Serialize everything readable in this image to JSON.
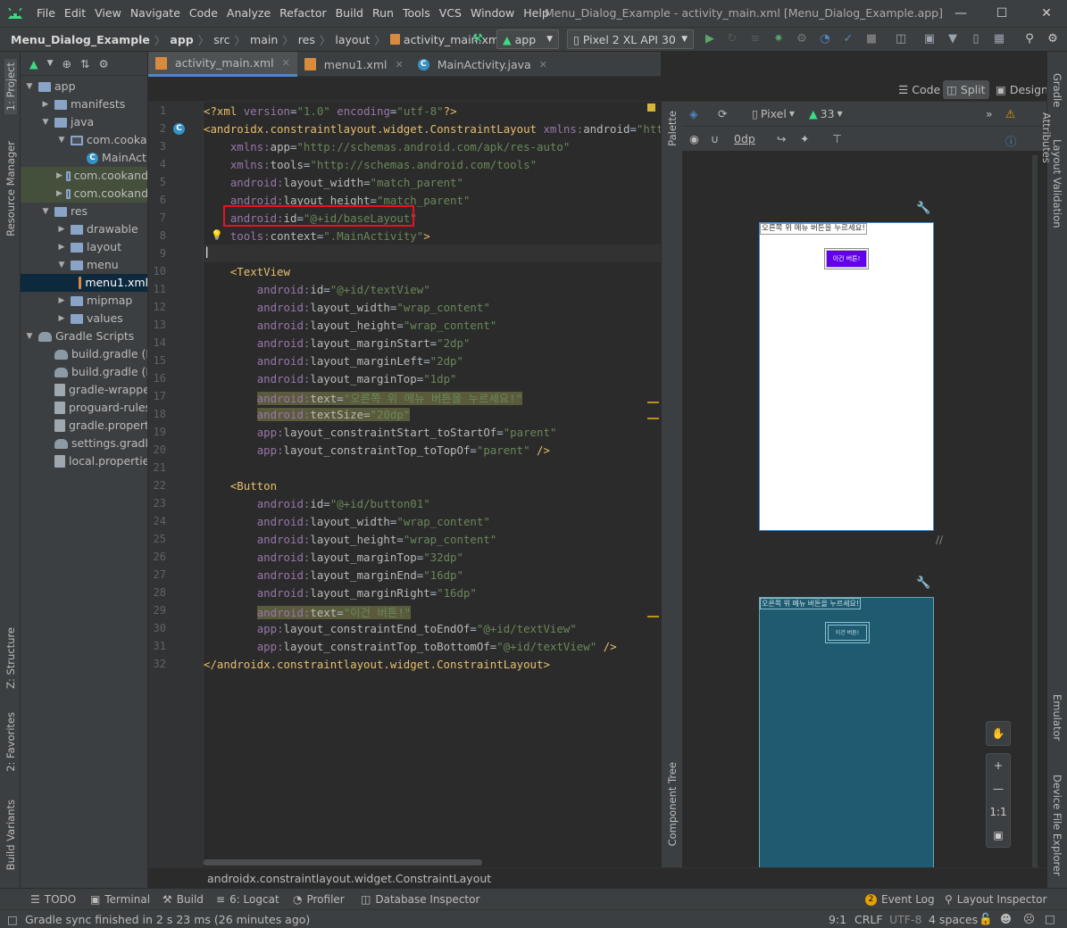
{
  "window": {
    "title": "Menu_Dialog_Example - activity_main.xml [Menu_Dialog_Example.app]",
    "menu": [
      "File",
      "Edit",
      "View",
      "Navigate",
      "Code",
      "Analyze",
      "Refactor",
      "Build",
      "Run",
      "Tools",
      "VCS",
      "Window",
      "Help"
    ]
  },
  "nav": {
    "crumbs": [
      "Menu_Dialog_Example",
      "app",
      "src",
      "main",
      "res",
      "layout",
      "activity_main.xml"
    ],
    "config": "app",
    "device": "Pixel 2 XL API 30"
  },
  "project": {
    "tree": [
      {
        "label": "app",
        "indent": 0,
        "arrow": "▼",
        "icon": "folder"
      },
      {
        "label": "manifests",
        "indent": 1,
        "arrow": "▶",
        "icon": "folder"
      },
      {
        "label": "java",
        "indent": 1,
        "arrow": "▼",
        "icon": "folder"
      },
      {
        "label": "com.cookand",
        "indent": 2,
        "arrow": "▼",
        "icon": "pkg"
      },
      {
        "label": "MainActivi",
        "indent": 3,
        "arrow": "",
        "icon": "class"
      },
      {
        "label": "com.cookand",
        "indent": 2,
        "arrow": "▶",
        "icon": "pkg"
      },
      {
        "label": "com.cookand",
        "indent": 2,
        "arrow": "▶",
        "icon": "pkg"
      },
      {
        "label": "res",
        "indent": 1,
        "arrow": "▼",
        "icon": "folder"
      },
      {
        "label": "drawable",
        "indent": 2,
        "arrow": "▶",
        "icon": "folder"
      },
      {
        "label": "layout",
        "indent": 2,
        "arrow": "▶",
        "icon": "folder"
      },
      {
        "label": "menu",
        "indent": 2,
        "arrow": "▼",
        "icon": "folder"
      },
      {
        "label": "menu1.xml",
        "indent": 3,
        "arrow": "",
        "icon": "xml"
      },
      {
        "label": "mipmap",
        "indent": 2,
        "arrow": "▶",
        "icon": "folder"
      },
      {
        "label": "values",
        "indent": 2,
        "arrow": "▶",
        "icon": "folder"
      },
      {
        "label": "Gradle Scripts",
        "indent": 0,
        "arrow": "▼",
        "icon": "gradle"
      },
      {
        "label": "build.gradle (Pro",
        "indent": 1,
        "arrow": "",
        "icon": "gradle"
      },
      {
        "label": "build.gradle (Mo",
        "indent": 1,
        "arrow": "",
        "icon": "gradle"
      },
      {
        "label": "gradle-wrapper.p",
        "indent": 1,
        "arrow": "",
        "icon": "file"
      },
      {
        "label": "proguard-rules.p",
        "indent": 1,
        "arrow": "",
        "icon": "file"
      },
      {
        "label": "gradle.propertie",
        "indent": 1,
        "arrow": "",
        "icon": "file"
      },
      {
        "label": "settings.gradle (",
        "indent": 1,
        "arrow": "",
        "icon": "gradle"
      },
      {
        "label": "local.properties",
        "indent": 1,
        "arrow": "",
        "icon": "file"
      }
    ]
  },
  "left_tabs": [
    "1: Project",
    "Resource Manager",
    "Z: Structure",
    "2: Favorites",
    "Build Variants"
  ],
  "right_tabs": [
    "Gradle",
    "Layout Validation",
    "Attributes",
    "Emulator",
    "Device File Explorer"
  ],
  "editor_tabs": [
    {
      "label": "activity_main.xml",
      "active": true
    },
    {
      "label": "menu1.xml",
      "active": false
    },
    {
      "label": "MainActivity.java",
      "active": false
    }
  ],
  "view_modes": [
    "Code",
    "Split",
    "Design"
  ],
  "palette_labels": {
    "palette": "Palette",
    "tree": "Component Tree"
  },
  "code_lines": [
    "1",
    "2",
    "3",
    "4",
    "5",
    "6",
    "7",
    "8",
    "9",
    "10",
    "11",
    "12",
    "13",
    "14",
    "15",
    "16",
    "17",
    "18",
    "19",
    "20",
    "21",
    "22",
    "23",
    "24",
    "25",
    "26",
    "27",
    "28",
    "29",
    "30",
    "31",
    "32"
  ],
  "design_toolbar": {
    "device": "Pixel",
    "api": "33",
    "margin": "0dp"
  },
  "preview": {
    "textview_text": "오른쪽 위 메뉴 버튼을 누르세요!",
    "button_text": "이건 버튼!"
  },
  "zoom": {
    "one_to_one": "1:1"
  },
  "editor_breadcrumb": "androidx.constraintlayout.widget.ConstraintLayout",
  "bottom_tools": [
    "TODO",
    "Terminal",
    "Build",
    "6: Logcat",
    "Profiler",
    "Database Inspector",
    "Event Log",
    "Layout Inspector"
  ],
  "event_log_count": "2",
  "status": {
    "message": "Gradle sync finished in 2 s 23 ms (26 minutes ago)",
    "position": "9:1",
    "line_sep": "CRLF",
    "encoding": "UTF-8",
    "indent": "4 spaces"
  },
  "colors": {
    "accent": "#4a88c7",
    "highlight_box": "#e81123",
    "button_purple": "#6200ee"
  }
}
